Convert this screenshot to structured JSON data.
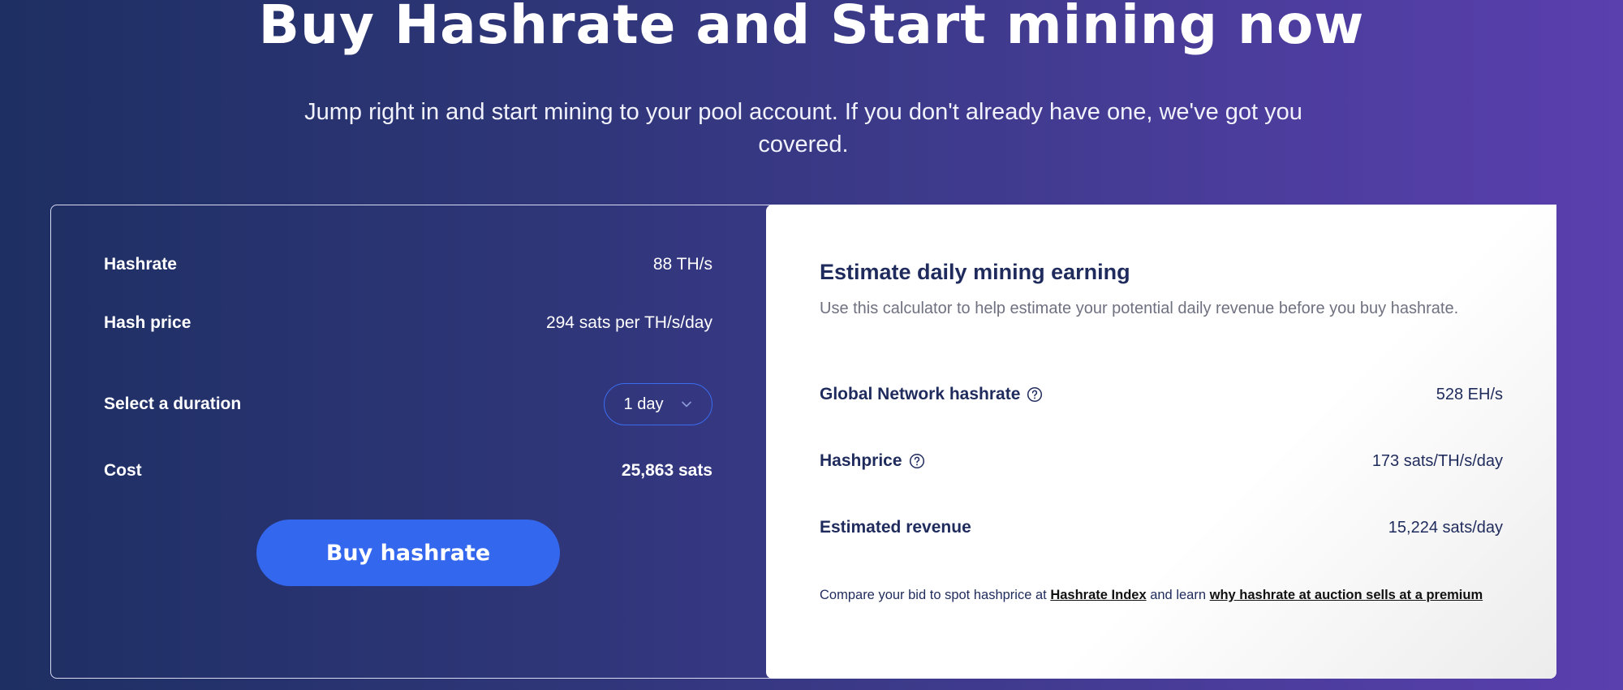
{
  "hero": {
    "title": "Buy Hashrate and Start mining now",
    "subtitle": "Jump right in and start mining to your pool account. If you don't already have one, we've got you covered."
  },
  "purchase": {
    "hashrate_label": "Hashrate",
    "hashrate_value": "88 TH/s",
    "hash_price_label": "Hash price",
    "hash_price_value": "294 sats per TH/s/day",
    "duration_label": "Select a duration",
    "duration_value": "1 day",
    "cost_label": "Cost",
    "cost_value": "25,863 sats",
    "buy_button": "Buy hashrate"
  },
  "calculator": {
    "title": "Estimate daily mining earning",
    "description": "Use this calculator to help estimate your potential daily revenue before you buy hashrate.",
    "network_label": "Global Network hashrate",
    "network_value": "528 EH/s",
    "hashprice_label": "Hashprice",
    "hashprice_value": "173 sats/TH/s/day",
    "revenue_label": "Estimated revenue",
    "revenue_value": "15,224 sats/day",
    "footnote_prefix": "Compare your bid to spot hashprice at ",
    "footnote_link1": "Hashrate Index",
    "footnote_middle": " and learn ",
    "footnote_link2": "why hashrate at auction sells at a premium"
  },
  "colors": {
    "accent": "#3367ee",
    "bg_start": "#1e2f63",
    "bg_end": "#5a3fae",
    "text_dark": "#1f2b5c"
  },
  "icons": {
    "help": "question-circle-icon",
    "dropdown": "chevron-down-icon"
  }
}
